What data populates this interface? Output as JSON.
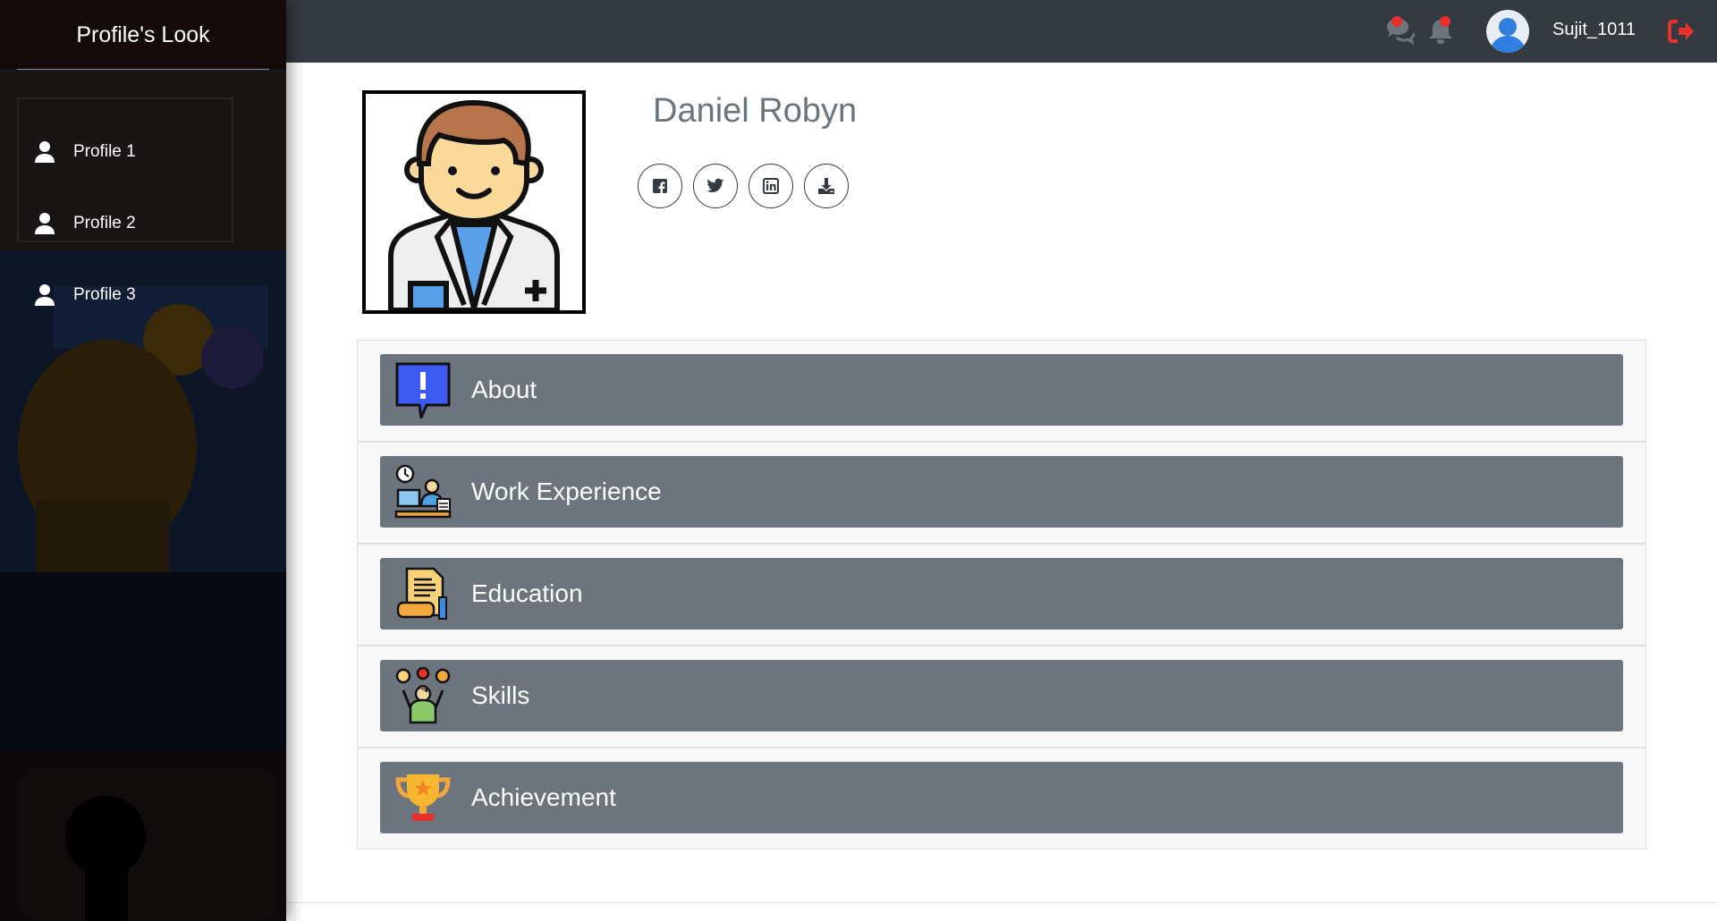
{
  "brand": "Profile's Look",
  "sidebar": {
    "items": [
      {
        "label": "Profile 1",
        "icon": "user-icon"
      },
      {
        "label": "Profile 2",
        "icon": "user-icon"
      },
      {
        "label": "Profile 3",
        "icon": "user-icon"
      }
    ]
  },
  "topbar": {
    "icons": [
      "comments-icon",
      "bell-icon",
      "avatar",
      "logout-icon"
    ],
    "username": "Sujit_1011",
    "badge_color": "#e8302c",
    "logout_color": "#e8302c"
  },
  "profile": {
    "name": "Daniel Robyn",
    "socials": [
      "facebook-icon",
      "twitter-icon",
      "linkedin-icon",
      "download-icon"
    ]
  },
  "sections": [
    {
      "label": "About",
      "icon": "info-speech-icon"
    },
    {
      "label": "Work Experience",
      "icon": "work-desk-icon"
    },
    {
      "label": "Education",
      "icon": "certificate-scroll-icon"
    },
    {
      "label": "Skills",
      "icon": "skills-person-icon"
    },
    {
      "label": "Achievement",
      "icon": "trophy-icon"
    }
  ],
  "colors": {
    "topbar": "#343a40",
    "section_header": "#6c757d",
    "name_text": "#6c757d"
  }
}
